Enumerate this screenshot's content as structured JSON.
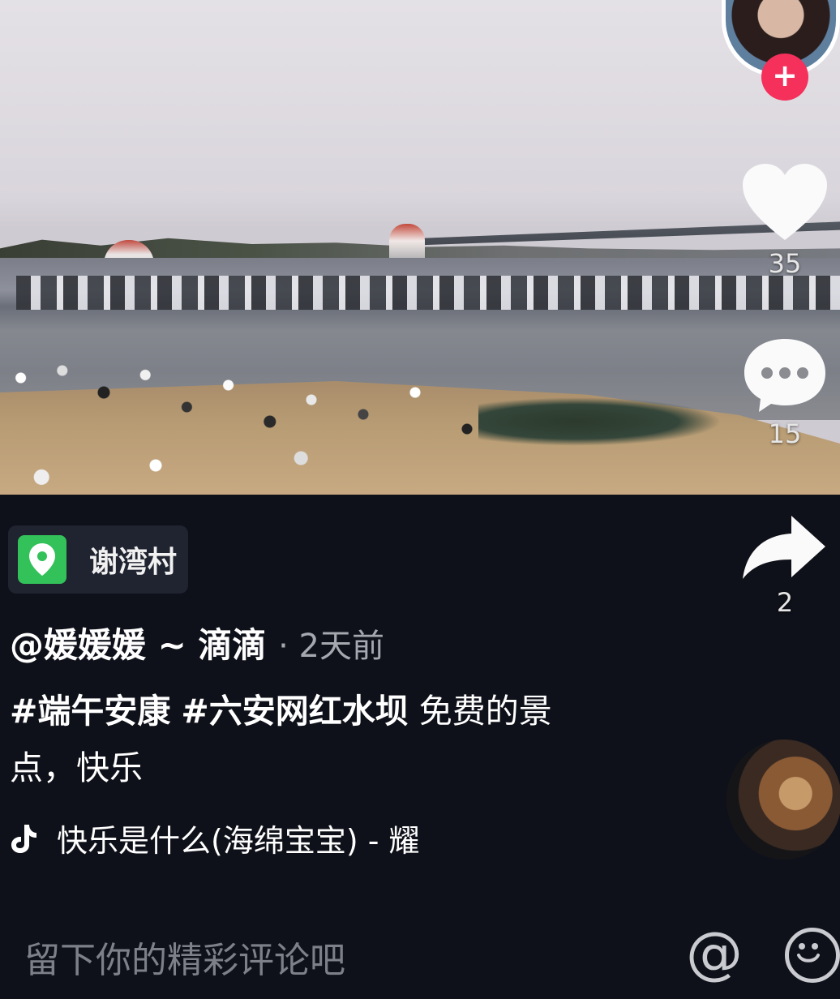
{
  "author": {
    "avatar": "author-avatar",
    "follow_symbol": "+"
  },
  "actions": {
    "likes": "35",
    "comments": "15",
    "shares": "2"
  },
  "location": {
    "name": "谢湾村",
    "icon": "map-pin-icon"
  },
  "post": {
    "username": "@媛媛媛 ~ 滴滴",
    "time": "· 2天前",
    "hashtag1": "#端午安康",
    "hashtag2": "#六安网红水坝",
    "caption_rest": " 免费的景点，快乐"
  },
  "music": {
    "icon": "tiktok-note-icon",
    "title": "快乐是什么(海绵宝宝) - 耀"
  },
  "comment_bar": {
    "placeholder": "留下你的精彩评论吧",
    "at_symbol": "@",
    "emoji_icon": "smiley-icon"
  },
  "colors": {
    "background": "#0f111a",
    "follow": "#f4305b",
    "location_green": "#33c15a"
  }
}
